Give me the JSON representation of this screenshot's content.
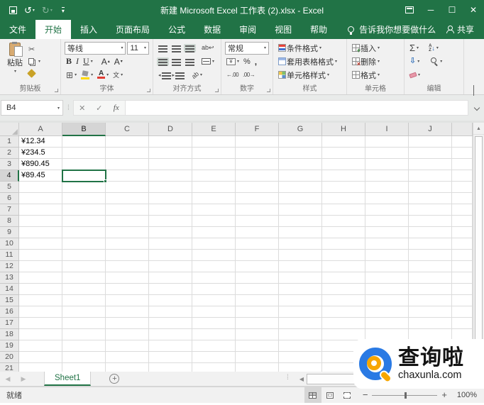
{
  "colors": {
    "accent": "#217346",
    "titlebar": "#217346",
    "selection": "#217346",
    "fill_yellow": "#ffd900",
    "font_red": "#e03c32"
  },
  "titlebar": {
    "title": "新建 Microsoft Excel 工作表 (2).xlsx - Excel"
  },
  "ribbon_tabs": [
    "文件",
    "开始",
    "插入",
    "页面布局",
    "公式",
    "数据",
    "审阅",
    "视图",
    "帮助"
  ],
  "active_tab": "开始",
  "tell_me": "告诉我你想要做什么",
  "share_label": "共享",
  "ribbon": {
    "clipboard": {
      "label": "剪贴板",
      "paste": "粘贴"
    },
    "font": {
      "label": "字体",
      "name": "等线",
      "size": "11",
      "bold": "B",
      "italic": "I",
      "underline": "U",
      "grow_letter": "A",
      "shrink_letter": "A",
      "phonetic": "文"
    },
    "alignment": {
      "label": "对齐方式",
      "wrap_ab": "ab↩",
      "orient_ab": "ab"
    },
    "number": {
      "label": "数字",
      "format": "常规",
      "currency_symbol": "¥",
      "percent": "%",
      "comma": ",",
      "increase_decimal": "←.00",
      "decrease_decimal": ".00→"
    },
    "styles": {
      "label": "样式",
      "items": [
        "条件格式",
        "套用表格格式",
        "单元格样式"
      ]
    },
    "cells": {
      "label": "单元格",
      "items": [
        "插入",
        "删除",
        "格式"
      ]
    },
    "editing": {
      "label": "编辑",
      "autosum": "Σ",
      "sort_a": "A",
      "sort_z": "Z"
    }
  },
  "formula_bar": {
    "name_box": "B4",
    "cancel": "✕",
    "enter": "✓",
    "fx": "fx",
    "value": ""
  },
  "grid": {
    "columns": [
      "A",
      "B",
      "C",
      "D",
      "E",
      "F",
      "G",
      "H",
      "I",
      "J"
    ],
    "row_count": 21,
    "selected_column": "B",
    "selected_row": 4,
    "active_cell": "B4",
    "cells": [
      {
        "ref": "A1",
        "value": "¥12.34"
      },
      {
        "ref": "A2",
        "value": "¥234.5"
      },
      {
        "ref": "A3",
        "value": "¥890.45"
      },
      {
        "ref": "A4",
        "value": "¥89.45"
      }
    ]
  },
  "sheet_bar": {
    "tabs": [
      "Sheet1"
    ],
    "active_tab": "Sheet1",
    "add_label": "+"
  },
  "status_bar": {
    "mode": "就绪",
    "zoom_level": "100%"
  },
  "watermark": {
    "title": "查询啦",
    "domain": "chaxunla.com"
  }
}
